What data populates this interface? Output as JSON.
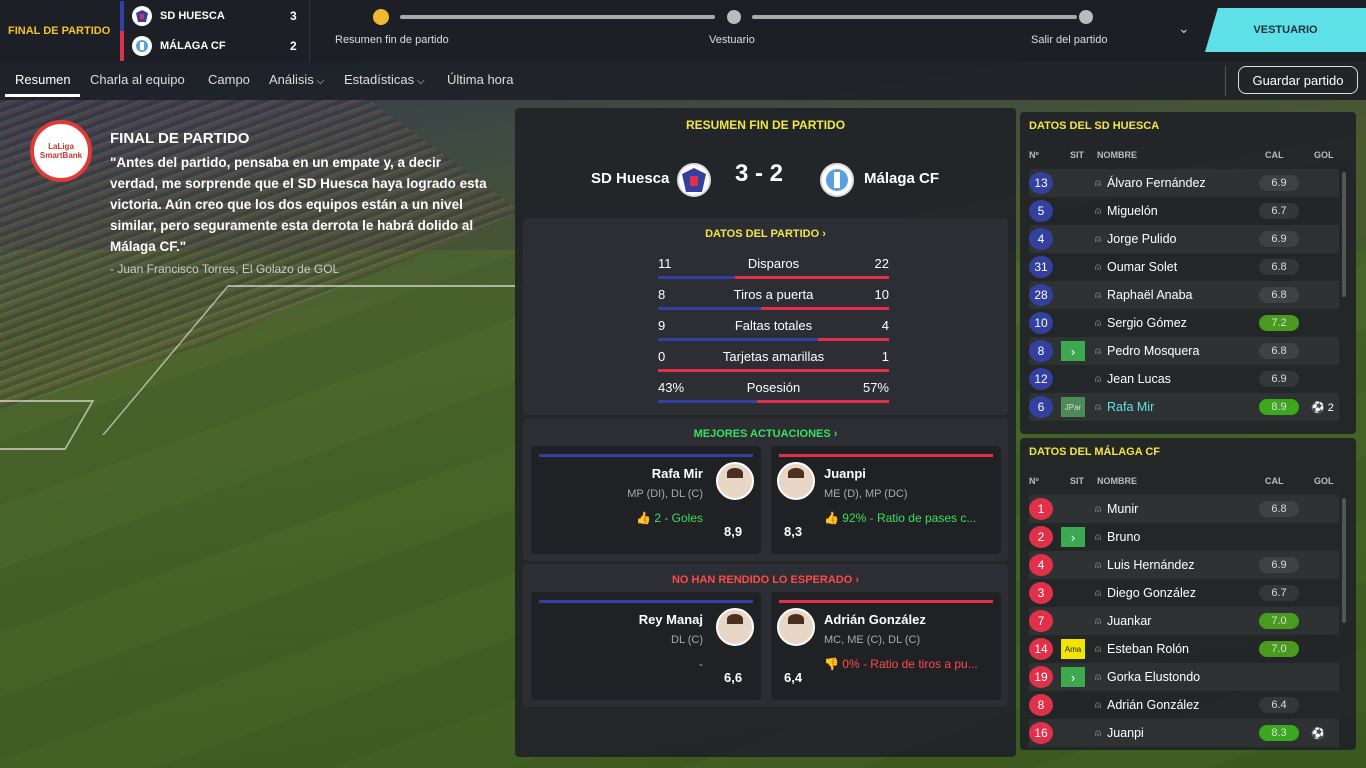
{
  "header": {
    "status": "FINAL DE PARTIDO",
    "home": {
      "name": "SD HUESCA",
      "score": "3"
    },
    "away": {
      "name": "MÁLAGA CF",
      "score": "2"
    },
    "steps": [
      "Resumen fin de partido",
      "Vestuario",
      "Salir del partido"
    ],
    "vestuario_button": "VESTUARIO"
  },
  "nav": {
    "items": [
      "Resumen",
      "Charla al equipo",
      "Campo",
      "Análisis",
      "Estadísticas",
      "Última hora"
    ],
    "save_button": "Guardar partido"
  },
  "quote": {
    "logo_text": "LaLiga SmartBank",
    "title": "FINAL DE PARTIDO",
    "text": "\"Antes del partido, pensaba en un empate y, a decir verdad, me sorprende que el SD Huesca haya logrado esta victoria. Aún creo que los dos equipos están a un nivel similar, pero seguramente esta derrota le habrá dolido al Málaga CF.\"",
    "source": "- Juan Francisco Torres, El Golazo de GOL"
  },
  "summary": {
    "title": "RESUMEN FIN DE PARTIDO",
    "home": "SD Huesca",
    "away": "Málaga CF",
    "score": "3 - 2",
    "match_data_title": "DATOS DEL PARTIDO ›",
    "stats": [
      {
        "label": "Disparos",
        "home": "11",
        "away": "22",
        "home_share": 0.333
      },
      {
        "label": "Tiros a puerta",
        "home": "8",
        "away": "10",
        "home_share": 0.444
      },
      {
        "label": "Faltas totales",
        "home": "9",
        "away": "4",
        "home_share": 0.692
      },
      {
        "label": "Tarjetas amarillas",
        "home": "0",
        "away": "1",
        "home_share": 0.0
      },
      {
        "label": "Posesión",
        "home": "43%",
        "away": "57%",
        "home_share": 0.43
      }
    ],
    "best_title": "MEJORES ACTUACIONES ›",
    "best": [
      {
        "name": "Rafa Mir",
        "pos": "MP (DI), DL (C)",
        "stat": "2 - Goles",
        "rating": "8,9"
      },
      {
        "name": "Juanpi",
        "pos": "ME (D), MP (DC)",
        "stat": "92% - Ratio de pases c...",
        "rating": "8,3"
      }
    ],
    "worst_title": "NO HAN RENDIDO LO ESPERADO ›",
    "worst": [
      {
        "name": "Rey Manaj",
        "pos": "DL (C)",
        "stat": "-",
        "rating": "6,6"
      },
      {
        "name": "Adrián González",
        "pos": "MC, ME (C), DL (C)",
        "stat": "0% - Ratio de tiros a pu...",
        "rating": "6,4"
      }
    ]
  },
  "columns": {
    "num": "Nº",
    "sit": "SIT",
    "name": "NOMBRE",
    "cal": "CAL",
    "gol": "GOL"
  },
  "huesca": {
    "title": "DATOS DEL SD HUESCA",
    "players": [
      {
        "num": "13",
        "name": "Álvaro Fernández",
        "cal": "6.9",
        "sit": "",
        "gol": ""
      },
      {
        "num": "5",
        "name": "Miguelón",
        "cal": "6.7",
        "sit": "",
        "gol": ""
      },
      {
        "num": "4",
        "name": "Jorge Pulido",
        "cal": "6.9",
        "sit": "",
        "gol": ""
      },
      {
        "num": "31",
        "name": "Oumar Solet",
        "cal": "6.8",
        "sit": "",
        "gol": ""
      },
      {
        "num": "28",
        "name": "Raphaël Anaba",
        "cal": "6.8",
        "sit": "",
        "gol": ""
      },
      {
        "num": "10",
        "name": "Sergio Gómez",
        "cal": "7.2",
        "sit": "",
        "gol": ""
      },
      {
        "num": "8",
        "name": "Pedro Mosquera",
        "cal": "6.8",
        "sit": ">",
        "gol": ""
      },
      {
        "num": "12",
        "name": "Jean Lucas",
        "cal": "6.9",
        "sit": "",
        "gol": ""
      },
      {
        "num": "6",
        "name": "Rafa Mir",
        "cal": "8.9",
        "sit": "JPar",
        "gol": "⚽ 2"
      }
    ]
  },
  "malaga": {
    "title": "DATOS DEL MÁLAGA CF",
    "players": [
      {
        "num": "1",
        "name": "Munir",
        "cal": "6.8",
        "sit": "",
        "gol": ""
      },
      {
        "num": "2",
        "name": "Bruno",
        "cal": "",
        "sit": ">",
        "gol": ""
      },
      {
        "num": "4",
        "name": "Luis Hernández",
        "cal": "6.9",
        "sit": "",
        "gol": ""
      },
      {
        "num": "3",
        "name": "Diego González",
        "cal": "6.7",
        "sit": "",
        "gol": ""
      },
      {
        "num": "7",
        "name": "Juankar",
        "cal": "7.0",
        "sit": "",
        "gol": ""
      },
      {
        "num": "14",
        "name": "Esteban Rolón",
        "cal": "7.0",
        "sit": "Ama",
        "gol": ""
      },
      {
        "num": "19",
        "name": "Gorka Elustondo",
        "cal": "",
        "sit": ">",
        "gol": ""
      },
      {
        "num": "8",
        "name": "Adrián González",
        "cal": "6.4",
        "sit": "",
        "gol": ""
      },
      {
        "num": "16",
        "name": "Juanpi",
        "cal": "8.3",
        "sit": "",
        "gol": "⚽"
      }
    ]
  },
  "colors": {
    "home": "#3440a0",
    "away": "#e0304a",
    "accent": "#f2e64a",
    "good_rating": "#3ca820"
  }
}
